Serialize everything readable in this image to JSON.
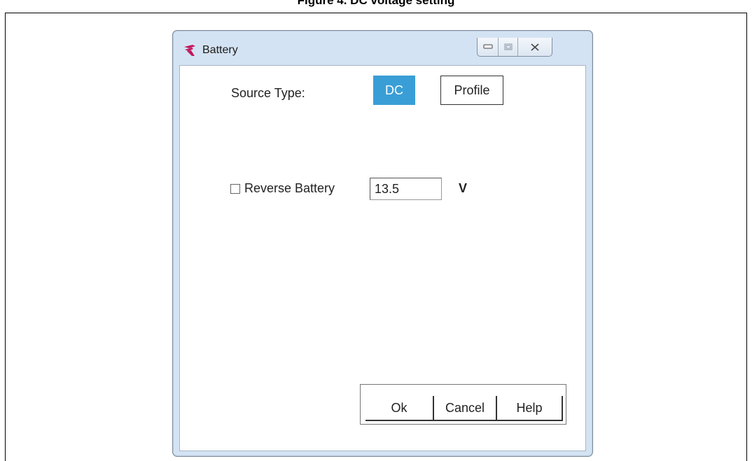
{
  "caption": "Figure 4. DC voltage setting",
  "window": {
    "title": "Battery",
    "app_icon": "app-logo-icon",
    "controls": [
      "minimize-icon",
      "maximize-icon",
      "close-icon"
    ]
  },
  "form": {
    "source_type_label": "Source Type:",
    "source_options": [
      "DC",
      "Profile"
    ],
    "selected_source": "DC",
    "reverse_battery_label": "Reverse Battery",
    "reverse_battery_checked": false,
    "voltage_value": "13.5",
    "voltage_unit": "V"
  },
  "buttons": {
    "ok": "Ok",
    "cancel": "Cancel",
    "help": "Help"
  },
  "colors": {
    "selected_accent": "#3a9ed6",
    "title_bar": "#d4e3f3",
    "app_icon": "#c2185b"
  }
}
